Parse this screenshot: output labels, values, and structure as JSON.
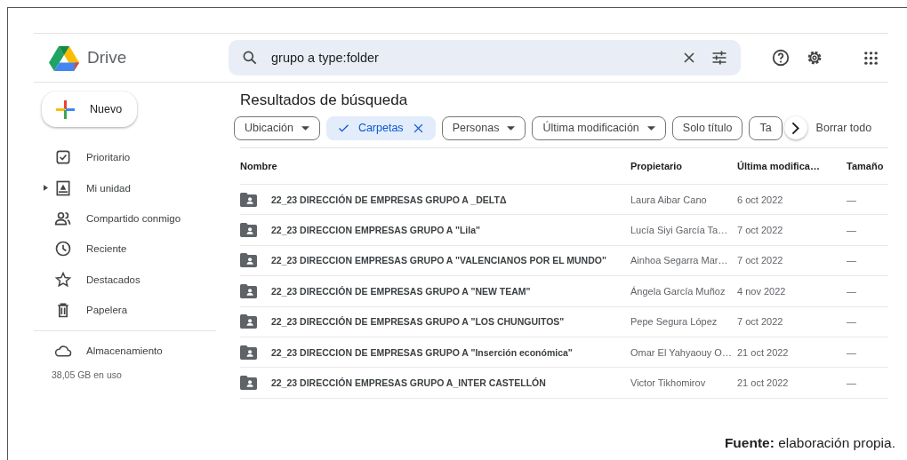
{
  "app": {
    "name": "Drive"
  },
  "search": {
    "value": "grupo a type:folder"
  },
  "new_button": {
    "label": "Nuevo"
  },
  "sidebar": {
    "items": [
      {
        "label": "Prioritario",
        "expandable": false
      },
      {
        "label": "Mi unidad",
        "expandable": true
      },
      {
        "label": "Compartido conmigo",
        "expandable": false
      },
      {
        "label": "Reciente",
        "expandable": false
      },
      {
        "label": "Destacados",
        "expandable": false
      },
      {
        "label": "Papelera",
        "expandable": false
      }
    ],
    "storage": {
      "label": "Almacenamiento",
      "usage": "38,05 GB en uso"
    }
  },
  "main": {
    "title": "Resultados de búsqueda",
    "filters": [
      {
        "label": "Ubicación",
        "selected": false,
        "has_menu": true
      },
      {
        "label": "Carpetas",
        "selected": true,
        "has_menu": false
      },
      {
        "label": "Personas",
        "selected": false,
        "has_menu": true
      },
      {
        "label": "Última modificación",
        "selected": false,
        "has_menu": true
      },
      {
        "label": "Solo título",
        "selected": false,
        "has_menu": false
      },
      {
        "label": "Ta",
        "selected": false,
        "has_menu": false
      }
    ],
    "clear_all": "Borrar todo",
    "table": {
      "columns": [
        "Nombre",
        "Propietario",
        "Última modifica…",
        "Tamaño"
      ],
      "rows": [
        {
          "name": "22_23 DIRECCIÓN DE EMPRESAS GRUPO A _DELTΔ",
          "owner": "Laura Aibar Cano",
          "modified": "6 oct 2022",
          "size": "—"
        },
        {
          "name": "22_23 DIRECCION EMPRESAS GRUPO A \"Lila\"",
          "owner": "Lucía Siyi García Ta…",
          "modified": "7 oct 2022",
          "size": "—"
        },
        {
          "name": "22_23 DIRECCION EMPRESAS GRUPO A  \"VALENCIANOS POR EL MUNDO\"",
          "owner": "Ainhoa Segarra Mar…",
          "modified": "7 oct 2022",
          "size": "—"
        },
        {
          "name": "22_23 DIRECCIÓN DE EMPRESAS GRUPO A \"NEW TEAM\"",
          "owner": "Ángela García Muñoz",
          "modified": "4 nov 2022",
          "size": "—"
        },
        {
          "name": "22_23 DIRECCIÓN DE EMPRESAS GRUPO A \"LOS CHUNGUITOS\"",
          "owner": "Pepe Segura López",
          "modified": "7 oct 2022",
          "size": "—"
        },
        {
          "name": "22_23 DIRECCION DE EMPRESAS GRUPO A \"Inserción económica\"",
          "owner": "Omar El Yahyaouy O…",
          "modified": "21 oct 2022",
          "size": "—"
        },
        {
          "name": "22_23 DIRECCIÓN EMPRESAS GRUPO A_INTER CASTELLÓN",
          "owner": "Victor Tikhomirov",
          "modified": "21 oct 2022",
          "size": "—"
        }
      ]
    }
  },
  "caption": {
    "text": "**Fuente:** elaboración propia."
  }
}
